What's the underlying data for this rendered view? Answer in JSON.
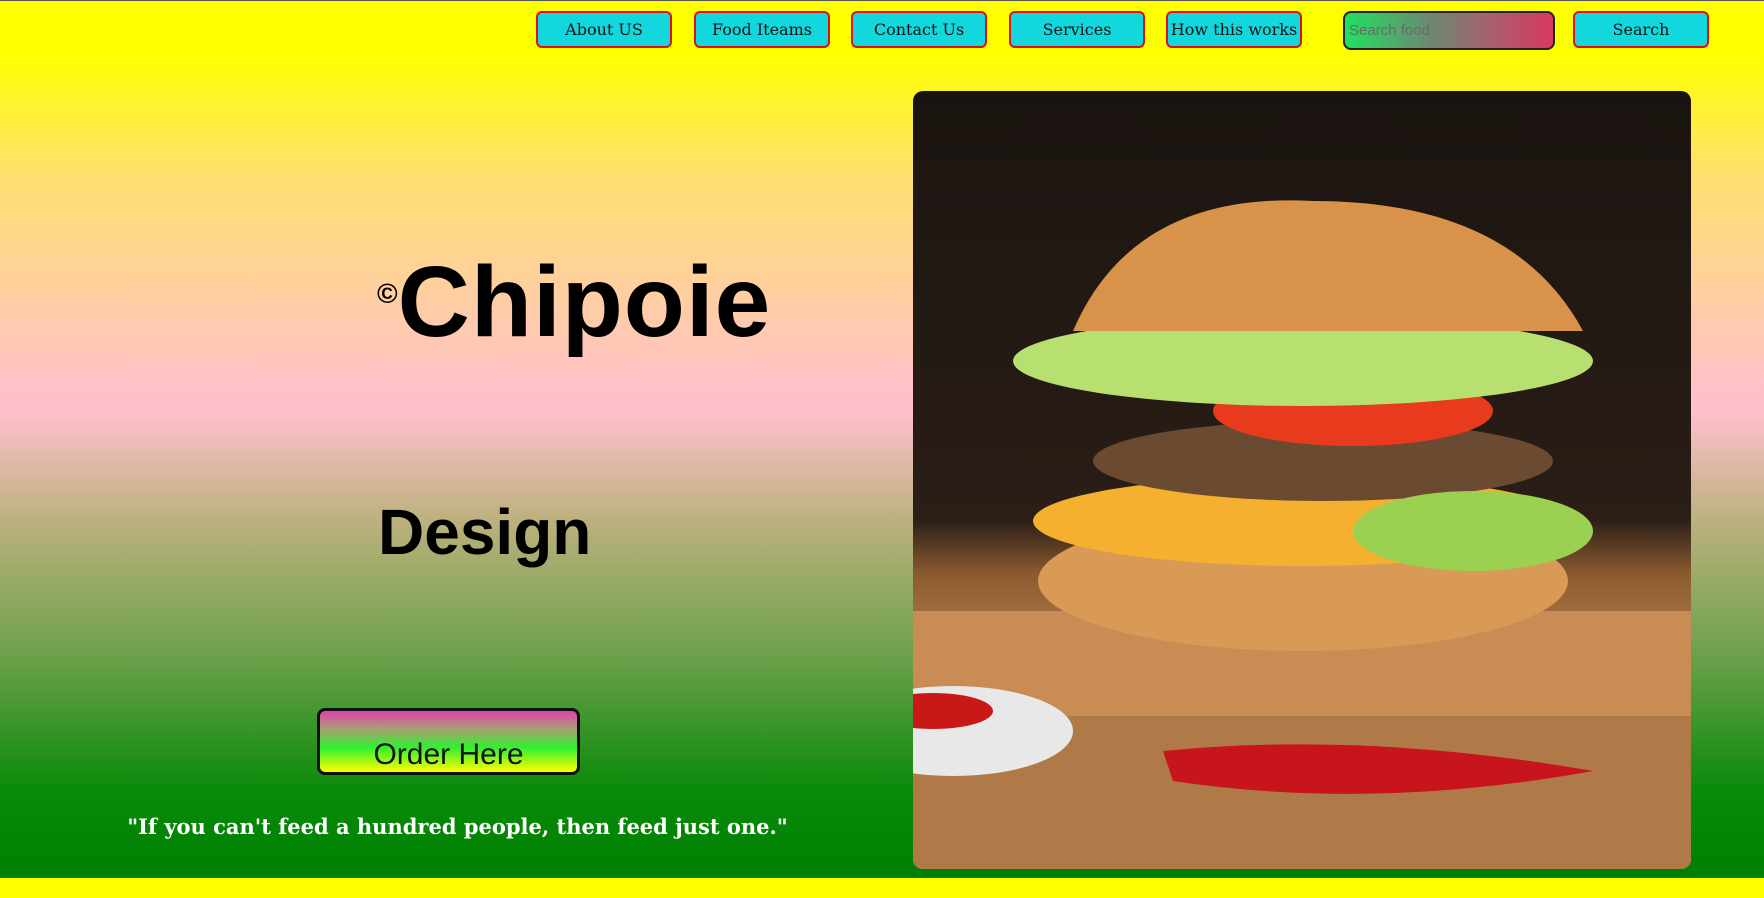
{
  "nav": {
    "items": [
      {
        "label": "About US"
      },
      {
        "label": "Food Iteams"
      },
      {
        "label": "Contact Us"
      },
      {
        "label": "Services"
      },
      {
        "label": "How this works"
      }
    ],
    "search_placeholder": "Search food",
    "search_button": "Search"
  },
  "hero": {
    "brand_mark": "©",
    "brand_name": "Chipoie",
    "subtitle": "Design",
    "order_button": "Order Here",
    "quote": "\"If you can't feed a hundred people, then feed just one.\""
  },
  "image": {
    "subject": "burger-photo"
  },
  "colors": {
    "nav_button_bg": "#12d8de",
    "nav_button_border": "#dd1111",
    "page_background": "#ffff00"
  }
}
